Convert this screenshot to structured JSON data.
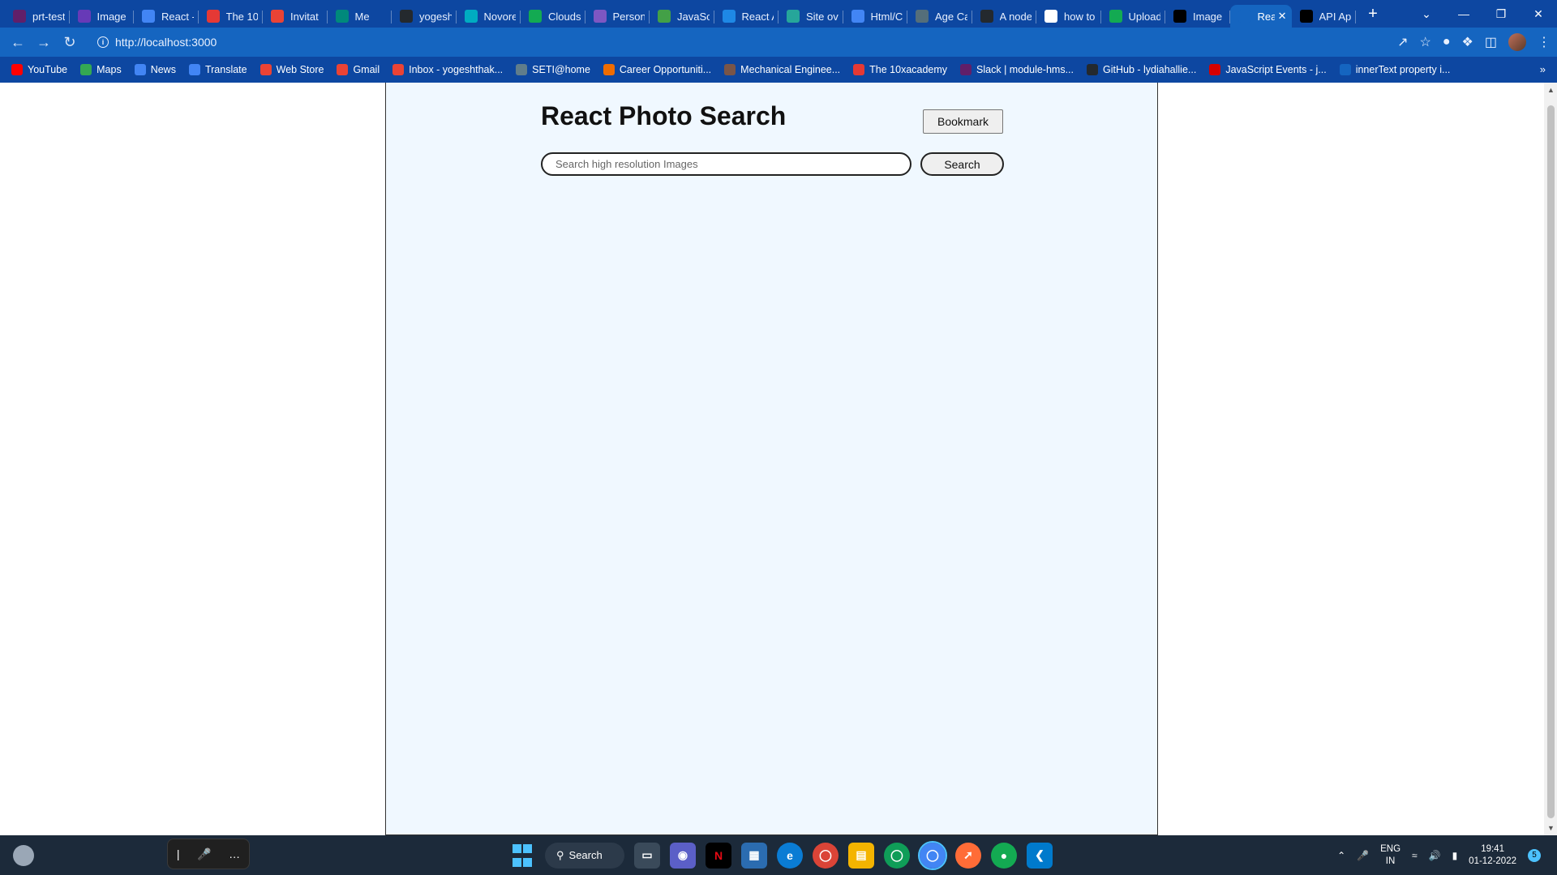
{
  "browser": {
    "tabs": [
      {
        "title": "prt-test",
        "icon": "slack-icon",
        "color": "#611f69",
        "active": false
      },
      {
        "title": "Image",
        "icon": "forms-icon",
        "color": "#673ab7",
        "active": false
      },
      {
        "title": "React -",
        "icon": "docs-icon",
        "color": "#4285f4",
        "active": false
      },
      {
        "title": "The 10",
        "icon": "academy-icon",
        "color": "#e53935",
        "active": false
      },
      {
        "title": "Invitat",
        "icon": "gmail-icon",
        "color": "#ea4335",
        "active": false
      },
      {
        "title": "Me",
        "icon": "meet-icon",
        "color": "#00897b",
        "active": false
      },
      {
        "title": "yogesh",
        "icon": "github-icon",
        "color": "#24292e",
        "active": false
      },
      {
        "title": "Novore",
        "icon": "n-icon",
        "color": "#00acc1",
        "active": false
      },
      {
        "title": "Clouds",
        "icon": "mongodb-icon",
        "color": "#13aa52",
        "active": false
      },
      {
        "title": "Person",
        "icon": "h-icon",
        "color": "#7e57c2",
        "active": false
      },
      {
        "title": "JavaSc",
        "icon": "js-icon",
        "color": "#43a047",
        "active": false
      },
      {
        "title": "React A",
        "icon": "react-icon",
        "color": "#1e88e5",
        "active": false
      },
      {
        "title": "Site ov",
        "icon": "diamond-icon",
        "color": "#26a69a",
        "active": false
      },
      {
        "title": "Html/C",
        "icon": "docs-icon",
        "color": "#4285f4",
        "active": false
      },
      {
        "title": "Age Ca",
        "icon": "globe-icon",
        "color": "#546e7a",
        "active": false
      },
      {
        "title": "A node",
        "icon": "github-icon",
        "color": "#24292e",
        "active": false
      },
      {
        "title": "how to",
        "icon": "google-icon",
        "color": "#ffffff",
        "active": false
      },
      {
        "title": "Upload",
        "icon": "mongodb-icon",
        "color": "#13aa52",
        "active": false
      },
      {
        "title": "Image",
        "icon": "unsplash-icon",
        "color": "#000000",
        "active": false
      },
      {
        "title": "Rea",
        "icon": "react-icon",
        "color": "#1565c0",
        "active": true
      },
      {
        "title": "API Ap",
        "icon": "unsplash-icon",
        "color": "#000000",
        "active": false
      }
    ],
    "url": "http://localhost:3000",
    "bookmarks": [
      {
        "label": "YouTube",
        "icon": "youtube-icon",
        "color": "#ff0000"
      },
      {
        "label": "Maps",
        "icon": "maps-icon",
        "color": "#34a853"
      },
      {
        "label": "News",
        "icon": "news-icon",
        "color": "#4285f4"
      },
      {
        "label": "Translate",
        "icon": "translate-icon",
        "color": "#4285f4"
      },
      {
        "label": "Web Store",
        "icon": "webstore-icon",
        "color": "#ea4335"
      },
      {
        "label": "Gmail",
        "icon": "gmail-icon",
        "color": "#ea4335"
      },
      {
        "label": "Inbox - yogeshthak...",
        "icon": "gmail-icon",
        "color": "#ea4335"
      },
      {
        "label": "SETI@home",
        "icon": "seti-icon",
        "color": "#607d8b"
      },
      {
        "label": "Career Opportuniti...",
        "icon": "career-icon",
        "color": "#ef6c00"
      },
      {
        "label": "Mechanical Enginee...",
        "icon": "mech-icon",
        "color": "#795548"
      },
      {
        "label": "The 10xacademy",
        "icon": "academy-icon",
        "color": "#e53935"
      },
      {
        "label": "Slack | module-hms...",
        "icon": "slack-icon",
        "color": "#611f69"
      },
      {
        "label": "GitHub - lydiahallie...",
        "icon": "github-icon",
        "color": "#24292e"
      },
      {
        "label": "JavaScript Events - j...",
        "icon": "heart-icon",
        "color": "#d50000"
      },
      {
        "label": "innerText property i...",
        "icon": "mdn-icon",
        "color": "#1565c0"
      }
    ]
  },
  "app": {
    "title": "React Photo Search",
    "bookmark_label": "Bookmark",
    "search_placeholder": "Search high resolution Images",
    "search_label": "Search"
  },
  "taskbar": {
    "search_label": "Search",
    "lang_top": "ENG",
    "lang_bottom": "IN",
    "time": "19:41",
    "date": "01-12-2022",
    "notification_count": "5"
  }
}
